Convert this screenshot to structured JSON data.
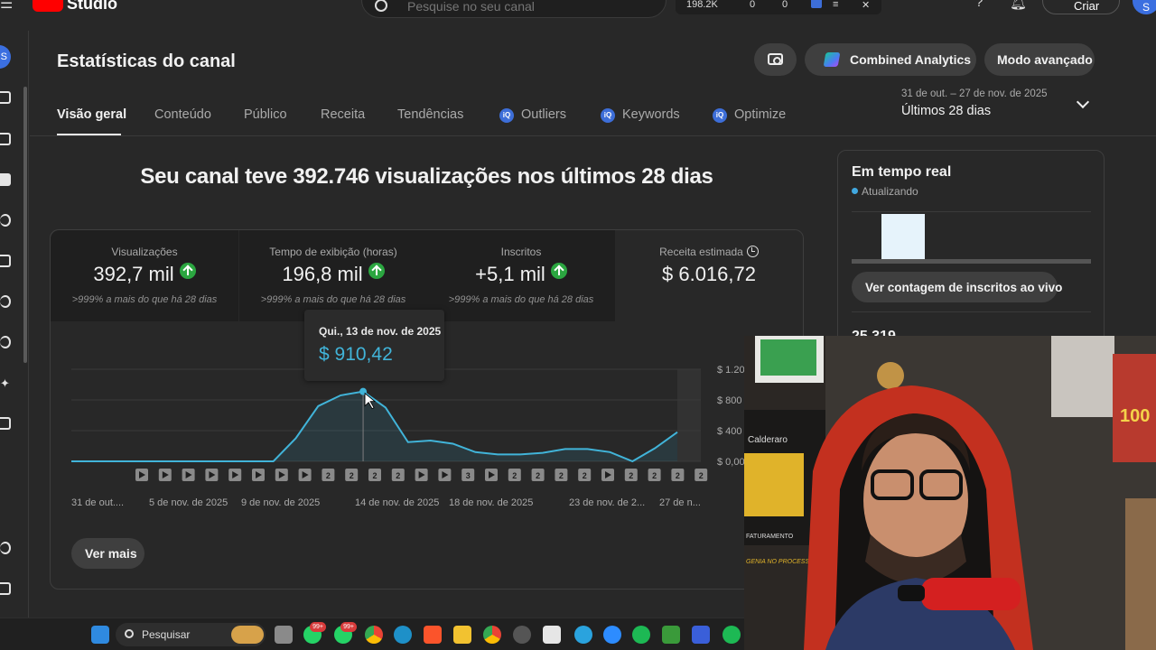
{
  "topbar": {
    "app_name": "Studio",
    "search_placeholder": "Pesquise no seu canal",
    "stat_views": "198.2K",
    "stat_a": "0",
    "stat_b": "0",
    "create_label": "Criar",
    "avatar_letter": "S"
  },
  "sidebar": {
    "avatar_letter": "S"
  },
  "page": {
    "title": "Estatísticas do canal",
    "combined_label": "Combined Analytics",
    "advanced_label": "Modo avançado"
  },
  "tabs": [
    {
      "label": "Visão geral"
    },
    {
      "label": "Conteúdo"
    },
    {
      "label": "Público"
    },
    {
      "label": "Receita"
    },
    {
      "label": "Tendências"
    },
    {
      "label": "Outliers",
      "badge": "iQ"
    },
    {
      "label": "Keywords",
      "badge": "iQ"
    },
    {
      "label": "Optimize",
      "badge": "iQ"
    }
  ],
  "date_range": {
    "range": "31 de out. – 27 de nov. de 2025",
    "label": "Últimos 28 dias"
  },
  "headline": "Seu canal teve 392.746 visualizações nos últimos 28 dias",
  "metrics": [
    {
      "label": "Visualizações",
      "value": "392,7 mil",
      "note": ">999% a mais do que há 28 dias",
      "trend": "up"
    },
    {
      "label": "Tempo de exibição (horas)",
      "value": "196,8 mil",
      "note": ">999% a mais do que há 28 dias",
      "trend": "up"
    },
    {
      "label": "Inscritos",
      "value": "+5,1 mil",
      "note": ">999% a mais do que há 28 dias",
      "trend": "up"
    },
    {
      "label": "Receita estimada",
      "value": "$ 6.016,72",
      "note": "",
      "trend": "none"
    }
  ],
  "tooltip": {
    "date": "Qui., 13 de nov. de 2025",
    "value": "$ 910,42"
  },
  "chart_data": {
    "type": "area",
    "series": [
      {
        "values": [
          0,
          0,
          0,
          0,
          0,
          0,
          0,
          0,
          0,
          0,
          300,
          720,
          860,
          910,
          700,
          250,
          270,
          230,
          120,
          90,
          90,
          110,
          160,
          160,
          120,
          0,
          170,
          380
        ]
      }
    ],
    "x_tick_labels": [
      "31 de out....",
      "5 de nov. de 2025",
      "9 de nov. de 2025",
      "14 de nov. de 2025",
      "18 de nov. de 2025",
      "23 de nov. de 2...",
      "27 de n..."
    ],
    "y_tick_labels": [
      "$ 0,00",
      "$ 400",
      "$ 800",
      "$ 1.20"
    ],
    "ylim": [
      0,
      1200
    ],
    "markers": [
      "play",
      "play",
      "play",
      "play",
      "play",
      "play",
      "play",
      "play",
      "2",
      "2",
      "2",
      "2",
      "play",
      "play",
      "3",
      "play",
      "2",
      "2",
      "2",
      "2",
      "play",
      "2",
      "2",
      "2",
      "2"
    ],
    "highlight_value": 910.42,
    "color": "#41b4d9"
  },
  "ver_mais": "Ver mais",
  "realtime": {
    "title": "Em tempo real",
    "status": "Atualizando",
    "button": "Ver contagem de inscritos ao vivo",
    "count": "25.319"
  },
  "webcam": {
    "poster_text": "Calderaro",
    "sign_text": "FATURAMENTO",
    "sign_text2": "GENIA NO PROCESSO",
    "frame_text": "100"
  },
  "taskbar": {
    "search_label": "Pesquisar",
    "badges": [
      "99+",
      "99+"
    ]
  },
  "colors": {
    "accent": "#41b4d9",
    "positive": "#2ba640",
    "brand": "#ff0000"
  }
}
